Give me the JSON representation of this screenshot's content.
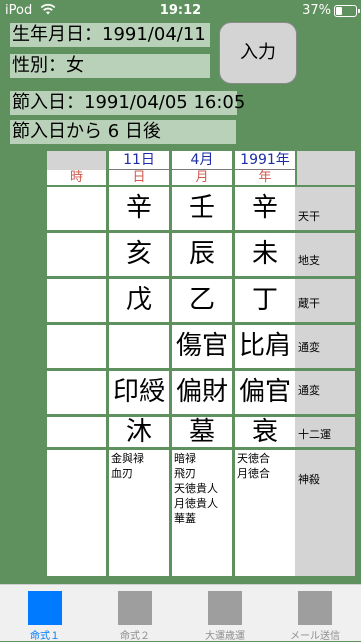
{
  "status": {
    "device": "iPod",
    "time": "19:12",
    "battery": "37%"
  },
  "info": {
    "birthdate": "生年月日：1991/04/11",
    "gender": "性別：女",
    "setsunyubi": "節入日：1991/04/05 16:05",
    "after": "節入日から 6 日後"
  },
  "input_button": "入力",
  "header": {
    "day": "11日",
    "month": "4月",
    "year": "1991年"
  },
  "header2": {
    "hour": "時",
    "day": "日",
    "month": "月",
    "year": "年"
  },
  "rows": {
    "tenkan": {
      "label": "天干",
      "hour": "",
      "day": "辛",
      "month": "壬",
      "year": "辛"
    },
    "chishi": {
      "label": "地支",
      "hour": "",
      "day": "亥",
      "month": "辰",
      "year": "未"
    },
    "zokan": {
      "label": "蔵干",
      "hour": "",
      "day": "戊",
      "month": "乙",
      "year": "丁"
    },
    "tsuhen1": {
      "label": "通変",
      "hour": "",
      "day": "",
      "month": "傷官",
      "year": "比肩"
    },
    "tsuhen2": {
      "label": "通変",
      "hour": "",
      "day": "印綬",
      "month": "偏財",
      "year": "偏官"
    },
    "juniun": {
      "label": "十二運",
      "hour": "",
      "day": "沐",
      "month": "墓",
      "year": "衰"
    }
  },
  "shinsatsu": {
    "label": "神殺",
    "hour": "",
    "day": [
      "金與禄",
      "血刃"
    ],
    "month": [
      "暗禄",
      "飛刃",
      "天徳貴人",
      "月徳貴人",
      "華蓋"
    ],
    "year": [
      "天徳合",
      "月徳合"
    ]
  },
  "tabs": [
    {
      "label": "命式１",
      "active": true
    },
    {
      "label": "命式２",
      "active": false
    },
    {
      "label": "大運歳運",
      "active": false
    },
    {
      "label": "メール送信",
      "active": false
    }
  ]
}
